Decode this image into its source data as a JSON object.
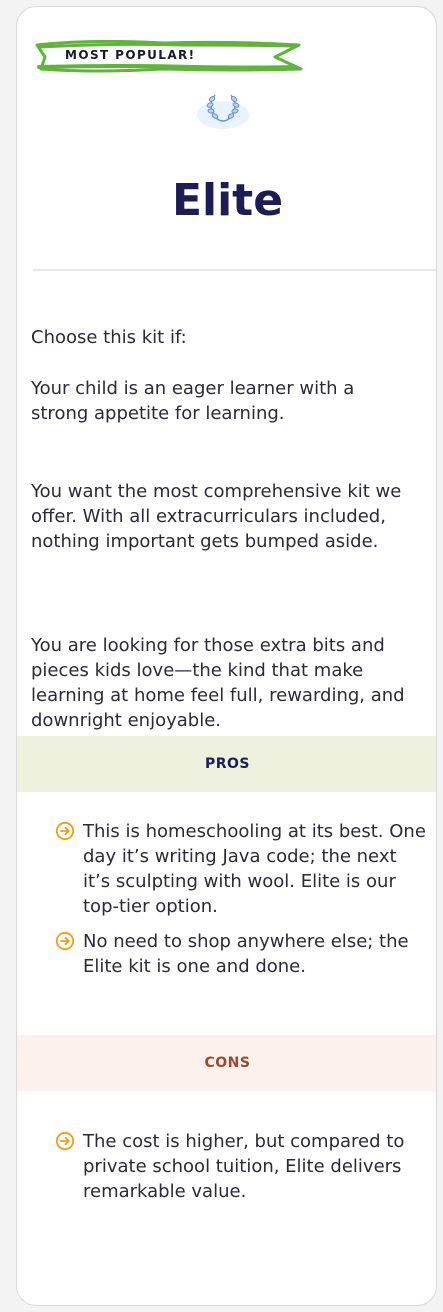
{
  "badge": {
    "label": "MOST POPULAR!"
  },
  "plan": {
    "title": "Elite"
  },
  "intro": {
    "heading": "Choose this kit if:"
  },
  "reasons": [
    "Your child is an eager learner with a strong appetite for learning.",
    "You want the most comprehensive kit we offer. With all extracurriculars included, nothing important gets bumped aside.",
    "You are looking for those extra bits and pieces kids love—the kind that make learning at home feel full, rewarding, and downright enjoyable."
  ],
  "pros": {
    "heading": "PROS",
    "items": [
      "This is homeschooling at its best. One day it’s writing Java code; the next it’s sculpting with wool. Elite is our top-tier option.",
      "No need to shop anywhere else; the Elite kit is one and done."
    ]
  },
  "cons": {
    "heading": "CONS",
    "items": [
      "The cost is higher, but compared to private school tuition, Elite delivers remarkable value."
    ]
  },
  "colors": {
    "ribbon": "#5db53a",
    "title": "#1d1d55",
    "arrow": "#f39c12",
    "pros_bg": "#eef1de",
    "cons_bg": "#fdf1ee",
    "cons_text": "#a2462b",
    "laurel": "#6a8fd6"
  },
  "icons": {
    "badge": "laurel-wreath-icon",
    "list_marker": "arrow-circle-right-icon"
  }
}
